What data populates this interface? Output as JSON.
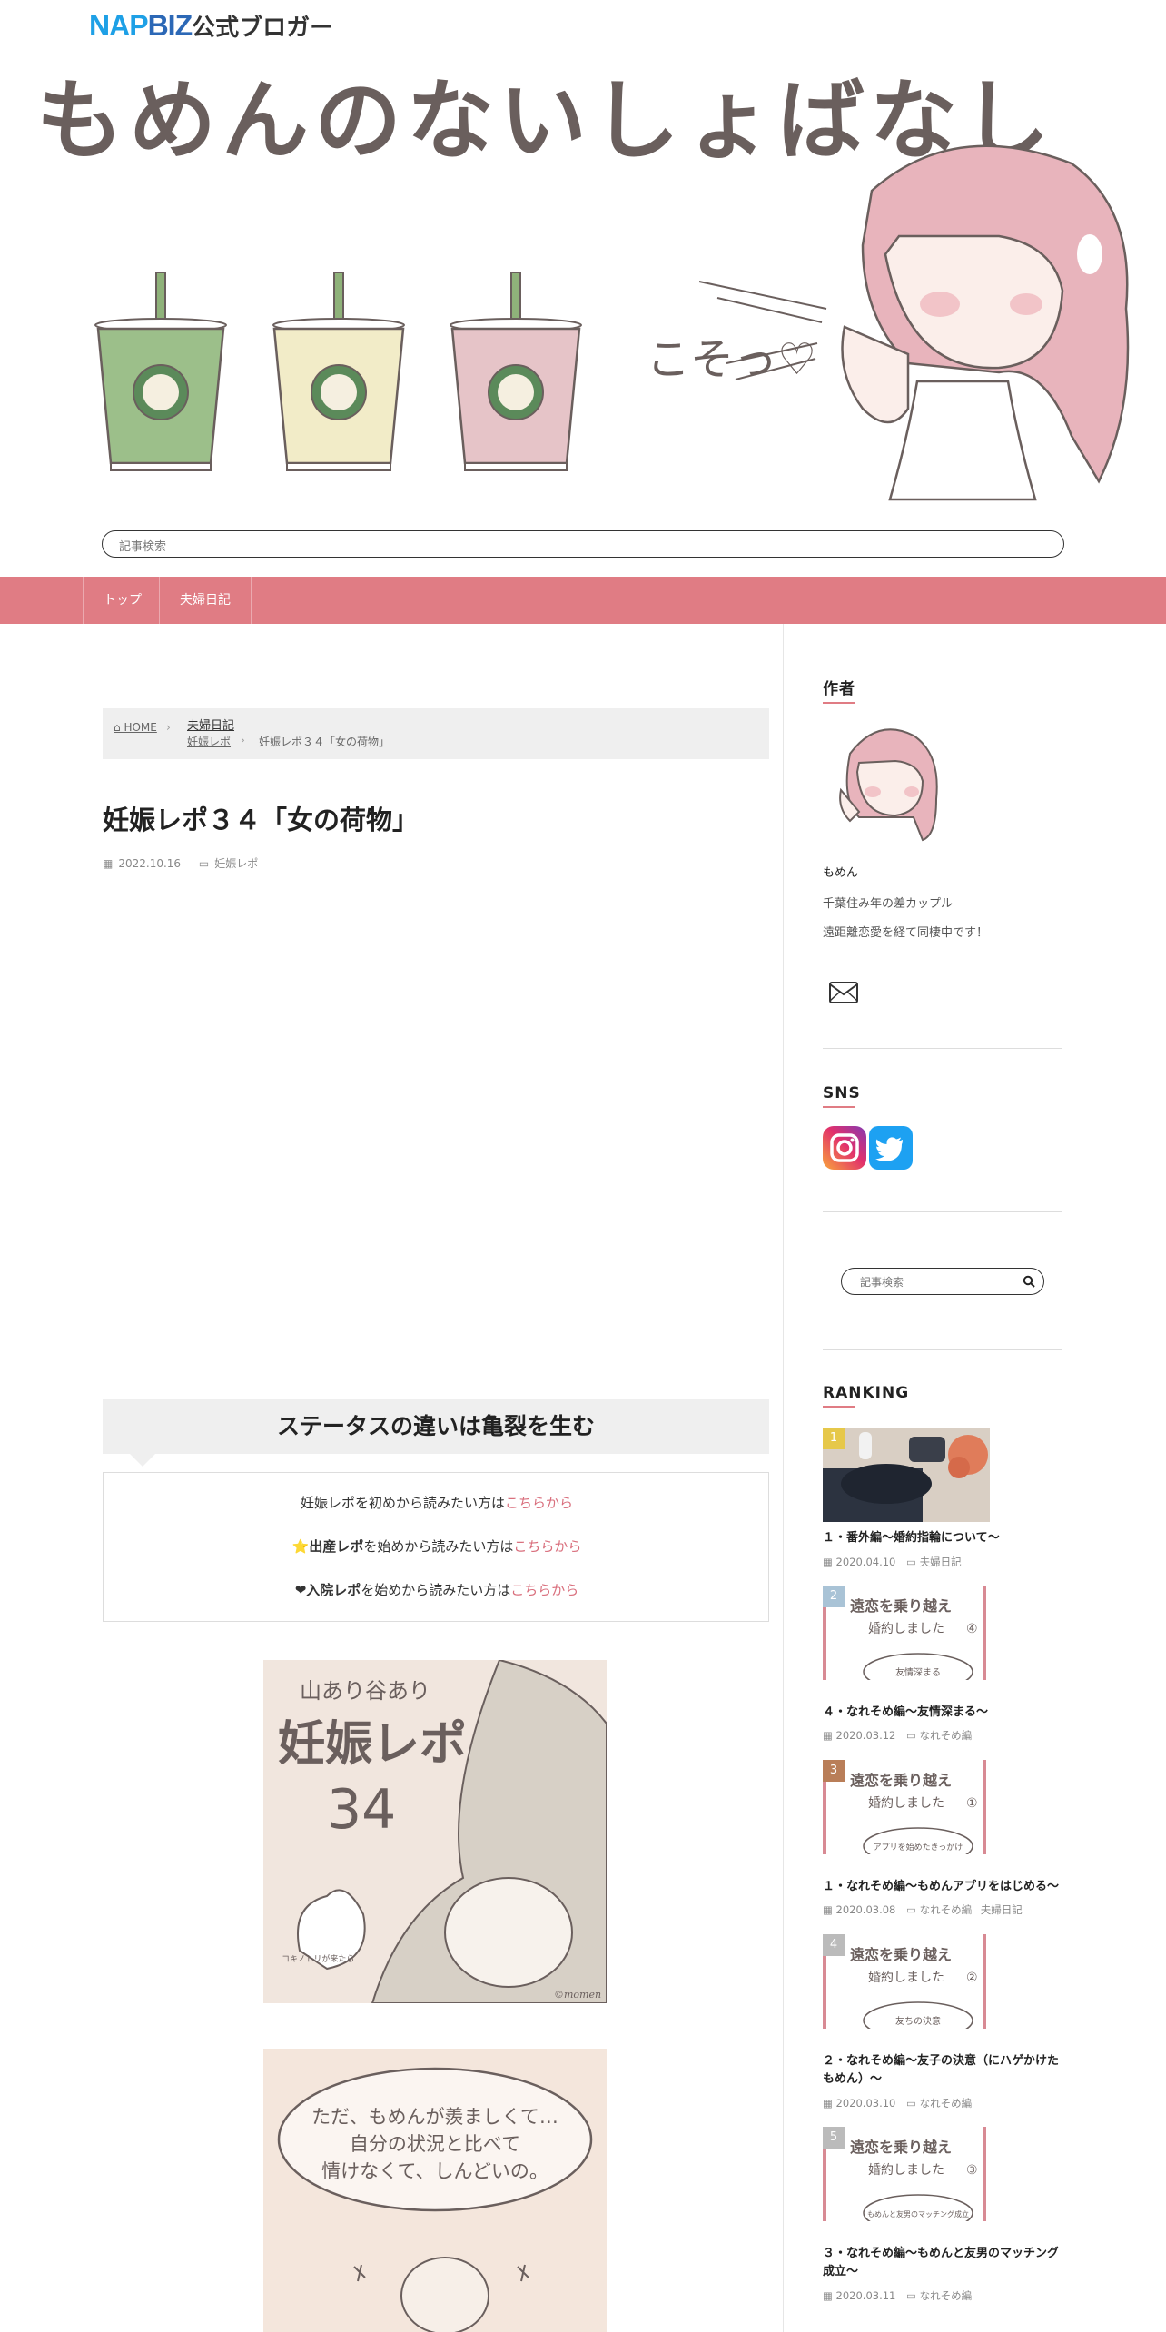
{
  "header": {
    "napbiz_nap": "NAP",
    "napbiz_biz": "BIZ",
    "napbiz_suffix": "公式ブロガー",
    "site_title": "もめんのないしょばなし",
    "illustration_text": "こそっ♡",
    "cup_colors": [
      "#9cbf8a",
      "#f2ecc8",
      "#e6c4c8"
    ],
    "search_placeholder": "記事検索"
  },
  "nav": {
    "items": [
      "トップ",
      "夫婦日記"
    ],
    "bg_color": "#e07c84"
  },
  "breadcrumb": {
    "home": "HOME",
    "category": "夫婦日記",
    "subcategory": "妊娠レポ",
    "current": "妊娠レポ３４「女の荷物」"
  },
  "post": {
    "title": "妊娠レポ３４「女の荷物」",
    "date": "2022.10.16",
    "category": "妊娠レポ",
    "section_heading": "ステータスの違いは亀裂を生む",
    "links": [
      {
        "prefix": "",
        "bold": "",
        "text": "妊娠レポを初めから読みたい方は",
        "link": "こちらから"
      },
      {
        "prefix": "⭐",
        "bold": "出産レポ",
        "text": "を始めから読みたい方は",
        "link": "こちらから"
      },
      {
        "prefix": "❤",
        "bold": "入院レポ",
        "text": "を始めから読みたい方は",
        "link": "こちらから"
      }
    ],
    "illust1": {
      "line1": "山あり谷あり",
      "line2": "妊娠レポ",
      "num": "34",
      "credit": "©momen",
      "tag": "コキノトリが来たら"
    },
    "illust2": {
      "line1": "ただ、もめんが羨ましくて…",
      "line2": "自分の状況と比べて",
      "line3": "情けなくて、しんどいの。"
    }
  },
  "sidebar": {
    "author_heading": "作者",
    "author_name": "もめん",
    "author_desc1": "千葉住み年の差カップル",
    "author_desc2": "遠距離恋愛を経て同棲中です！",
    "sns_heading": "SNS",
    "search_placeholder": "記事検索",
    "ranking_heading": "RANKING",
    "ranking": [
      {
        "rank": "1",
        "badge_color": "#e6c84a",
        "title": "１・番外編～婚約指輪について～",
        "date": "2020.04.10",
        "category": "夫婦日記",
        "thumb": "photo"
      },
      {
        "rank": "2",
        "badge_color": "#a9c3d6",
        "title": "４・なれそめ編～友情深まる～",
        "date": "2020.03.12",
        "category": "なれそめ編",
        "thumb": "comic",
        "thumb_line1": "遠恋を乗り越え",
        "thumb_line2": "婚約しました",
        "thumb_num": "④",
        "thumb_bubble": "友情深まる"
      },
      {
        "rank": "3",
        "badge_color": "#b97e58",
        "title": "１・なれそめ編～もめんアプリをはじめる～",
        "date": "2020.03.08",
        "category": "なれそめ編",
        "category2": "夫婦日記",
        "thumb": "comic",
        "thumb_line1": "遠恋を乗り越え",
        "thumb_line2": "婚約しました",
        "thumb_num": "①",
        "thumb_bubble": "アプリを始めたきっかけ"
      },
      {
        "rank": "4",
        "badge_color": "#bbbbbb",
        "title": "２・なれそめ編～友子の決意（にハゲかけたもめん）～",
        "date": "2020.03.10",
        "category": "なれそめ編",
        "thumb": "comic",
        "thumb_line1": "遠恋を乗り越え",
        "thumb_line2": "婚約しました",
        "thumb_num": "②",
        "thumb_bubble": "友ちの決意"
      },
      {
        "rank": "5",
        "badge_color": "#bbbbbb",
        "title": "３・なれそめ編～もめんと友男のマッチング成立～",
        "date": "2020.03.11",
        "category": "なれそめ編",
        "thumb": "comic",
        "thumb_line1": "遠恋を乗り越え",
        "thumb_line2": "婚約しました",
        "thumb_num": "③",
        "thumb_bubble": "もめんと友男のマッチング成立"
      }
    ]
  }
}
